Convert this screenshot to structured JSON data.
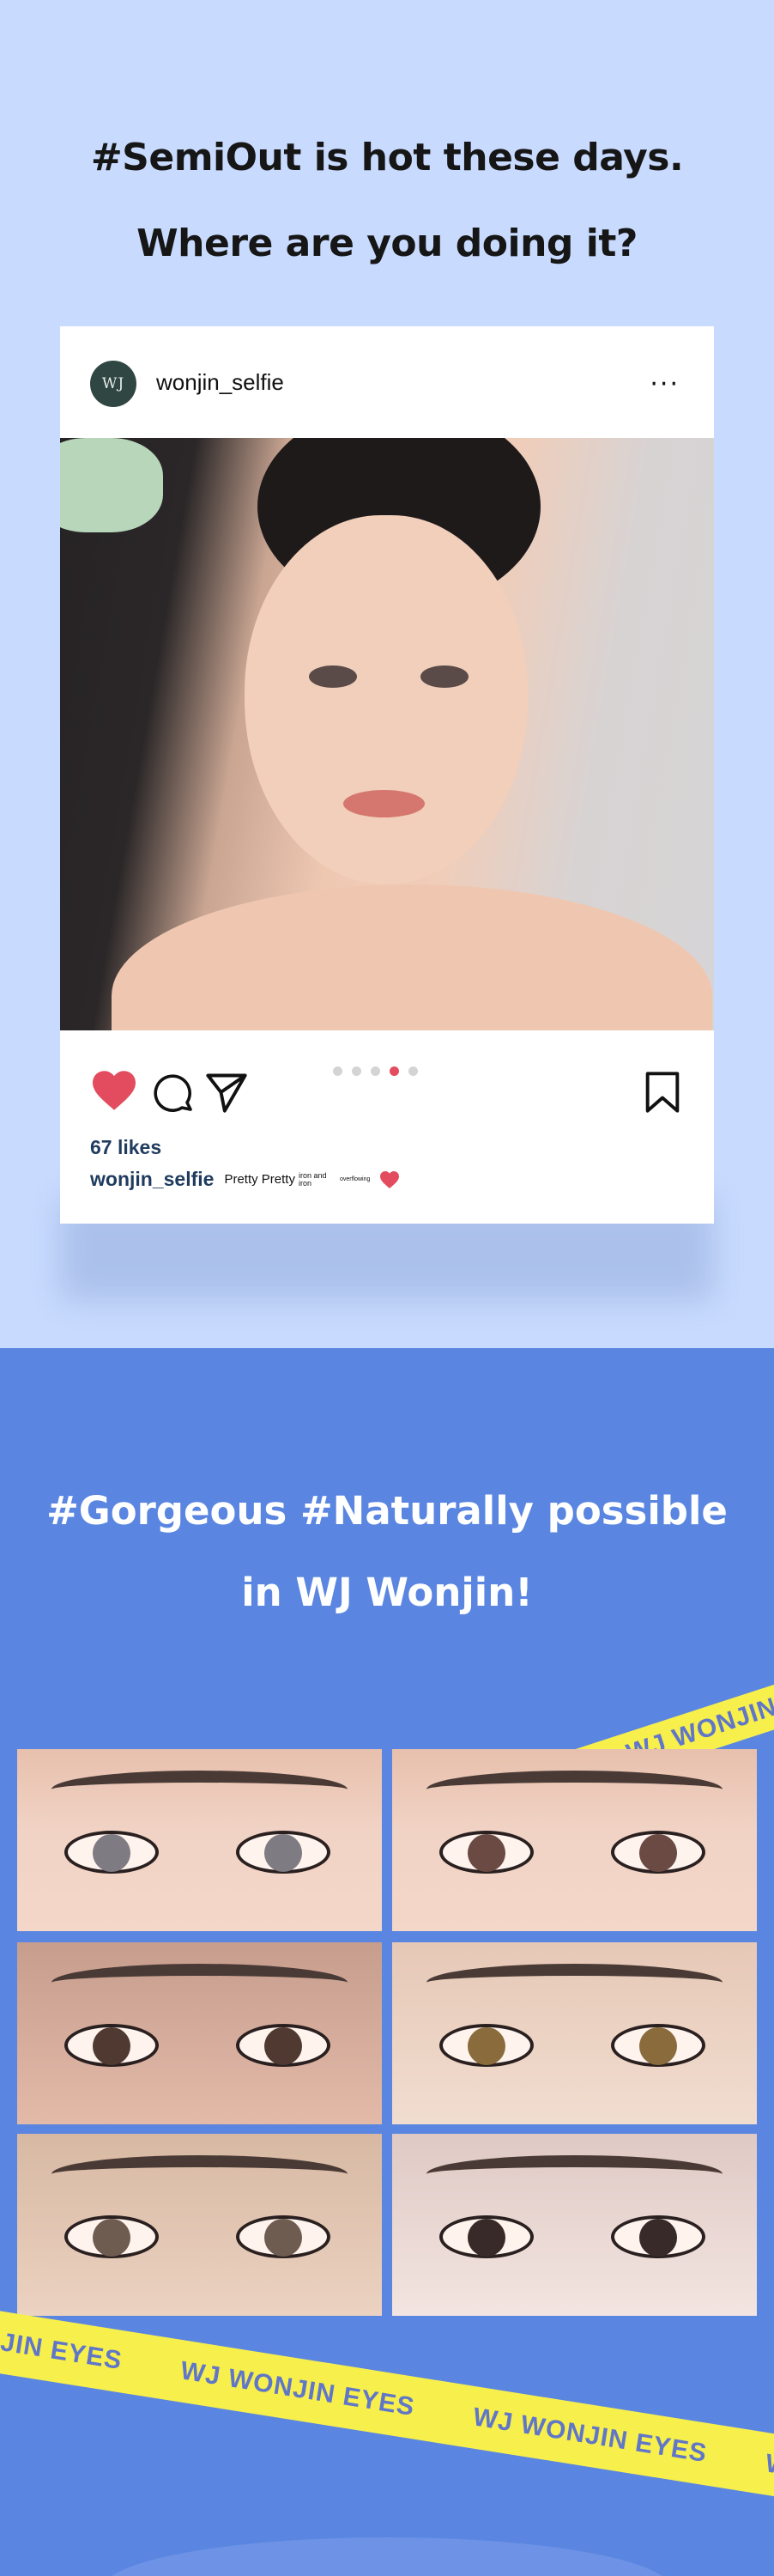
{
  "headline": {
    "line1": "#SemiOut is hot these days.",
    "line2": "Where are you doing it?"
  },
  "post": {
    "avatar_text": "WJ",
    "username": "wonjin_selfie",
    "more": "···",
    "likes": "67 likes",
    "caption_user": "wonjin_selfie",
    "caption_text": "Pretty Pretty",
    "caption_small": "iron and iron",
    "caption_tiny": "overflowing",
    "carousel_active_index": 3,
    "carousel_count": 5
  },
  "subheadline": {
    "line1": "#Gorgeous #Naturally possible",
    "line2": "in WJ Wonjin!"
  },
  "tape": {
    "top": "WJ WONJIN",
    "bottom": [
      "ONJIN EYES",
      "WJ WONJIN EYES",
      "WJ WONJIN EYES",
      "WJ WONJ"
    ]
  },
  "colors": {
    "top_bg": "#c8dafe",
    "bottom_bg": "#5a86e1",
    "tape": "#f7ef4c",
    "tape_text": "#6076c8",
    "heart": "#e34c5e",
    "username_text": "#1f3b5e"
  },
  "icons": [
    "heart-icon",
    "comment-icon",
    "send-icon",
    "bookmark-icon",
    "more-icon"
  ]
}
